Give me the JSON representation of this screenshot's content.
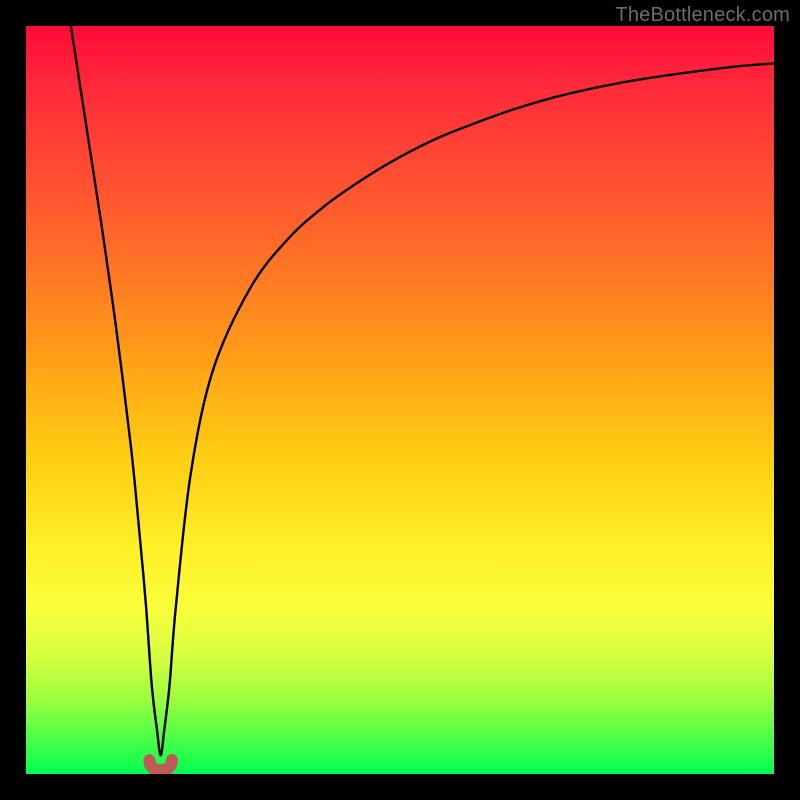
{
  "watermark": "TheBottleneck.com",
  "chart_data": {
    "type": "line",
    "title": "",
    "xlabel": "",
    "ylabel": "",
    "xlim": [
      0,
      100
    ],
    "ylim": [
      0,
      100
    ],
    "grid": false,
    "legend": false,
    "background": "rainbow-vertical",
    "notch": {
      "x": 18,
      "width": 3,
      "color": "#c05a58"
    },
    "series": [
      {
        "name": "curve",
        "color": "#000000",
        "x": [
          6,
          8,
          10,
          12,
          14,
          15,
          16,
          16.8,
          17.5,
          18,
          18.5,
          19.2,
          20,
          22,
          25,
          30,
          35,
          40,
          45,
          50,
          55,
          60,
          65,
          70,
          75,
          80,
          85,
          90,
          95,
          100
        ],
        "y": [
          100,
          87,
          74,
          60,
          44,
          34,
          23,
          12,
          6,
          2.5,
          6,
          12,
          22,
          40,
          54,
          65,
          71.5,
          76,
          79.5,
          82.5,
          85,
          87,
          88.8,
          90.3,
          91.5,
          92.5,
          93.3,
          94,
          94.6,
          95
        ]
      }
    ]
  }
}
